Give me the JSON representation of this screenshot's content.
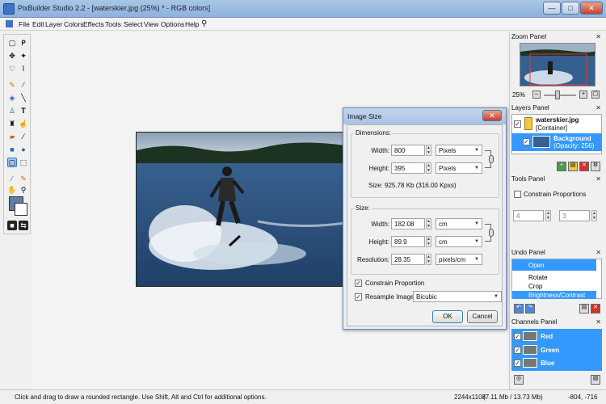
{
  "window": {
    "title": "PixBuilder Studio 2.2 - [waterskier.jpg (25%) * - RGB colors]",
    "min": "—",
    "max": "□",
    "close": "✕"
  },
  "menu": [
    "File",
    "Edit",
    "Layer",
    "Colors",
    "Effects",
    "Tools",
    "Select",
    "View",
    "Options",
    "Help"
  ],
  "dialog": {
    "title": "Image Size",
    "close": "✕",
    "dimensions_label": "Dimensions:",
    "width_label": "Width:",
    "width_value": "800",
    "width_unit": "Pixels",
    "height_label": "Height:",
    "height_value": "395",
    "height_unit": "Pixels",
    "size_info": "Size:    925.78 Kb  (316.00 Kpxs)",
    "size_label": "Size:",
    "doc_width_label": "Width:",
    "doc_width_value": "182.08",
    "doc_width_unit": "cm",
    "doc_height_label": "Height:",
    "doc_height_value": "89.9",
    "doc_height_unit": "cm",
    "resolution_label": "Resolution:",
    "resolution_value": "28.35",
    "resolution_unit": "pixels/cm",
    "constrain_label": "Constrain Proportion",
    "resample_label": "Resample Image:",
    "resample_value": "Bicubic",
    "ok": "OK",
    "cancel": "Cancel"
  },
  "zoom_panel": {
    "title": "Zoom Panel",
    "value": "25%"
  },
  "layers_panel": {
    "title": "Layers Panel",
    "layers": [
      {
        "name": "waterskier.jpg",
        "sub": "[Container]"
      },
      {
        "name": "Background",
        "sub": "(Opacity: 256)"
      }
    ]
  },
  "tools_panel": {
    "title": "Tools Panel",
    "constrain": "Constrain Proportions",
    "w": "4",
    "h": "3"
  },
  "undo_panel": {
    "title": "Undo Panel",
    "items": [
      "Open",
      "Rotate",
      "Crop",
      "Brightness/Contrast"
    ]
  },
  "channels_panel": {
    "title": "Channels Panel",
    "channels": [
      "Red",
      "Green",
      "Blue"
    ]
  },
  "status": {
    "hint": "Click and drag to draw a rounded rectangle. Use Shift, Alt and Ctrl for additional options.",
    "dims": "2244x1108",
    "mem": "(7.11 Mb / 13.73 Mb)",
    "coords": "-804, -716"
  },
  "colors": {
    "accent": "#3399ff",
    "title_gradient": "#a9c6e6"
  }
}
